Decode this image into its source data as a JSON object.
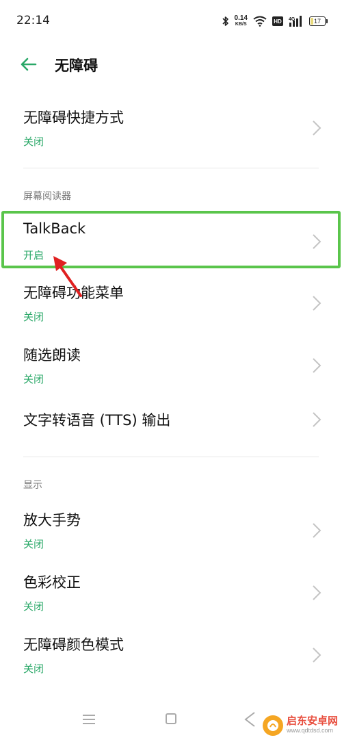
{
  "status_bar": {
    "time": "22:14",
    "net_speed_value": "0.14",
    "net_speed_unit": "KB/S",
    "hd_label": "HD",
    "network_type": "4G",
    "battery_level": "17"
  },
  "header": {
    "title": "无障碍"
  },
  "items": [
    {
      "title": "无障碍快捷方式",
      "subtitle": "关闭"
    },
    {
      "title": "TalkBack",
      "subtitle": "开启"
    },
    {
      "title": "无障碍功能菜单",
      "subtitle": "关闭"
    },
    {
      "title": "随选朗读",
      "subtitle": "关闭"
    },
    {
      "title": "文字转语音 (TTS) 输出",
      "subtitle": ""
    },
    {
      "title": "放大手势",
      "subtitle": "关闭"
    },
    {
      "title": "色彩校正",
      "subtitle": "关闭"
    },
    {
      "title": "无障碍颜色模式",
      "subtitle": "关闭"
    }
  ],
  "sections": {
    "screen_reader": "屏幕阅读器",
    "display": "显示"
  },
  "watermark": {
    "name": "启东安卓网",
    "url": "www.qdtdsd.com"
  },
  "colors": {
    "accent": "#2aa868",
    "highlight_border": "#5ac54b",
    "annotation_arrow": "#e02020"
  }
}
